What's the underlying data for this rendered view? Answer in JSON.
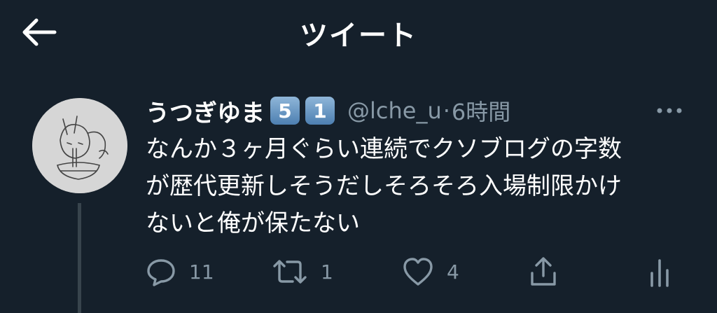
{
  "header": {
    "title": "ツイート",
    "back_icon": "arrow-left-icon"
  },
  "tweet": {
    "author_name": "うつぎゆま",
    "badges": [
      "5",
      "1"
    ],
    "handle": "@lche_u",
    "timestamp": "6時間",
    "separator": "·",
    "text_lines": [
      "なんか３ヶ月ぐらい連続でクソブログの字数",
      "が歴代更新しそうだしそろそろ入場制限かけ",
      "ないと俺が保たない"
    ]
  },
  "actions": {
    "reply": {
      "icon": "reply-icon",
      "count": "11"
    },
    "retweet": {
      "icon": "retweet-icon",
      "count": "1"
    },
    "like": {
      "icon": "heart-icon",
      "count": "4"
    },
    "share": {
      "icon": "share-icon"
    },
    "analytics": {
      "icon": "analytics-icon"
    }
  },
  "colors": {
    "background": "#15202b",
    "muted": "#8899a6",
    "thread": "#38444d"
  }
}
